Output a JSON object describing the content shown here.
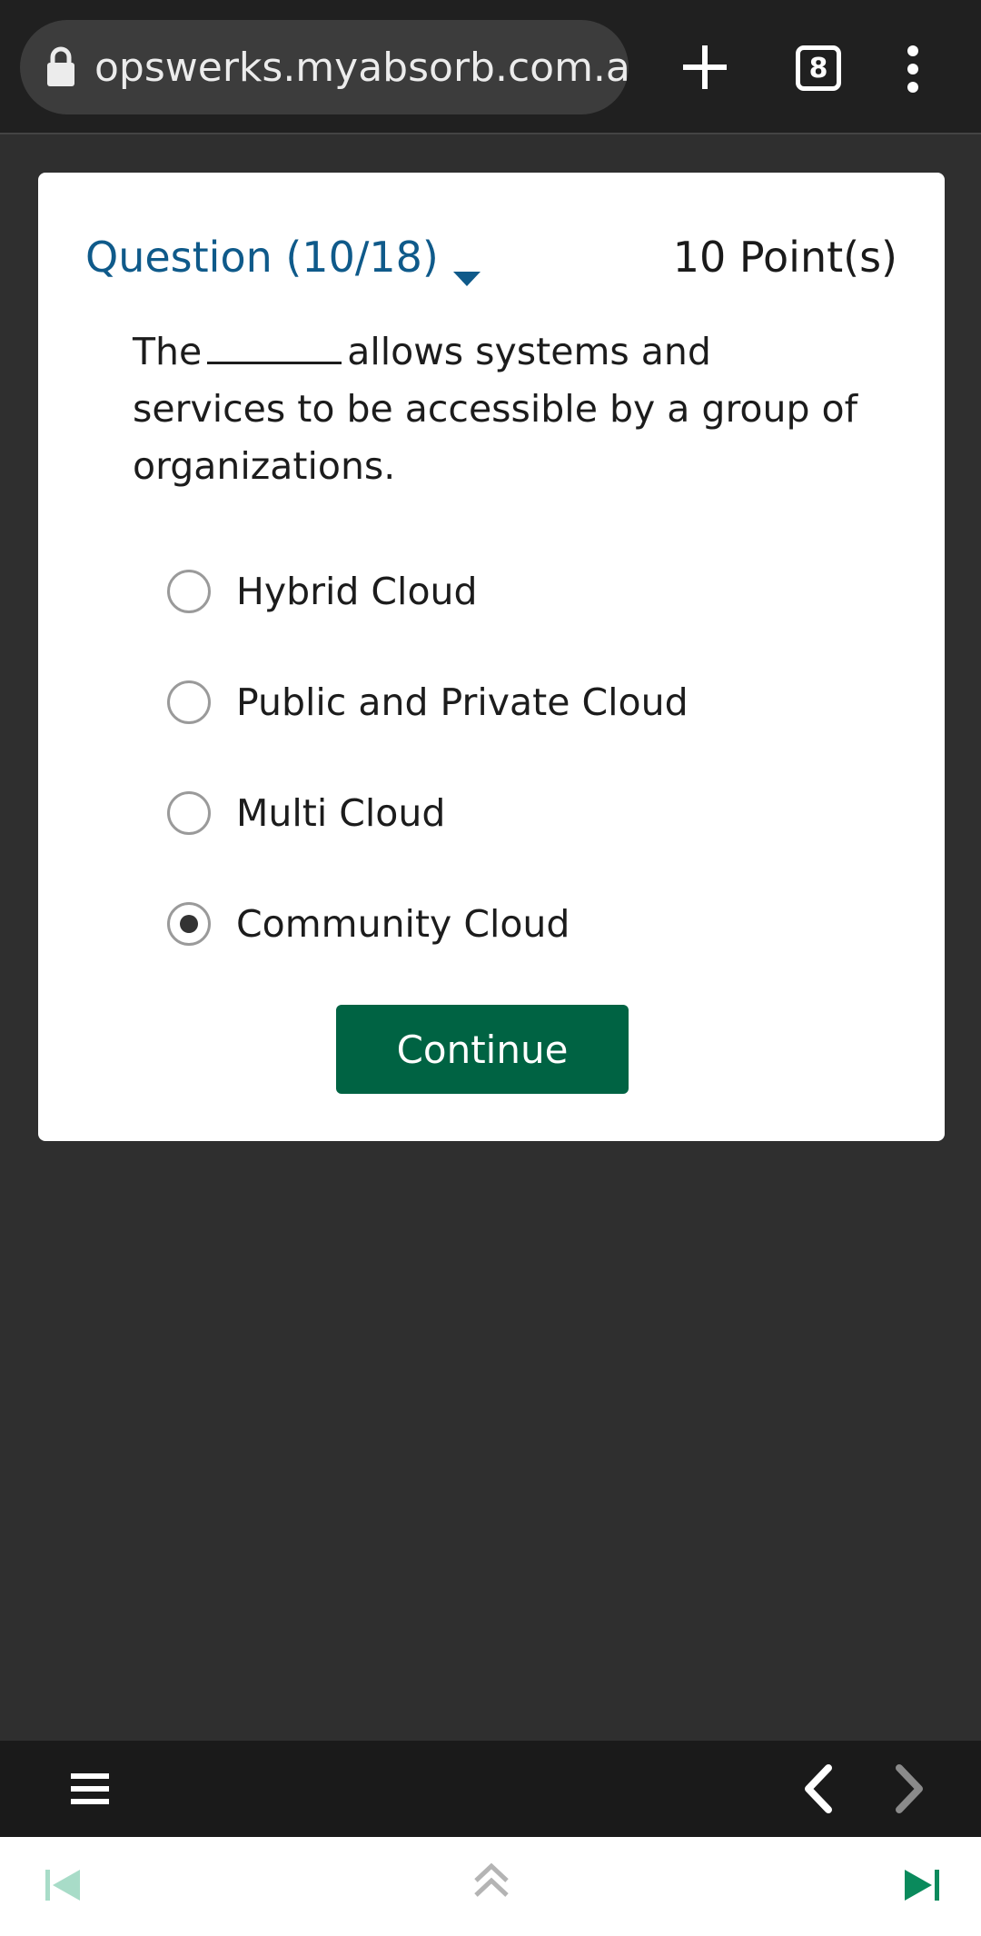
{
  "browser": {
    "url": "opswerks.myabsorb.com.au",
    "tab_count": "8"
  },
  "question": {
    "title": "Question (10/18)",
    "points": "10 Point(s)",
    "text_before": "The",
    "text_after": "allows systems and services to be accessible by a group of organizations.",
    "options": [
      {
        "label": "Hybrid Cloud",
        "selected": false
      },
      {
        "label": "Public and Private Cloud",
        "selected": false
      },
      {
        "label": "Multi Cloud",
        "selected": false
      },
      {
        "label": "Community Cloud",
        "selected": true
      }
    ],
    "continue_label": "Continue"
  },
  "colors": {
    "accent_blue": "#0f5a8a",
    "button_green": "#006343",
    "nav_green": "#0a8a5c"
  }
}
